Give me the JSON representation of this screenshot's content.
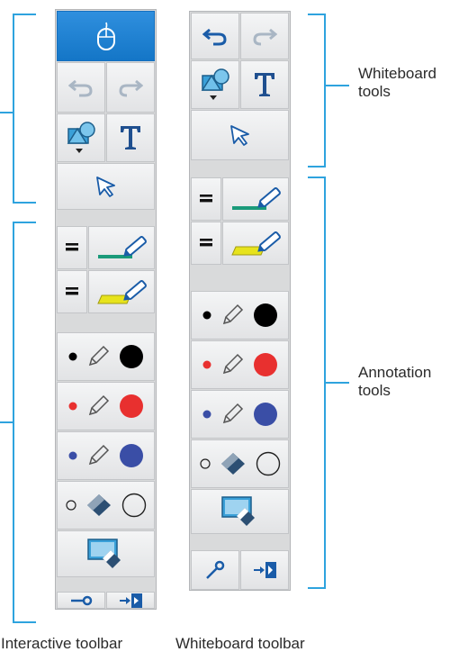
{
  "labels": {
    "whiteboard_tools": "Whiteboard tools",
    "annotation_tools": "Annotation tools"
  },
  "captions": {
    "interactive_toolbar": "Interactive toolbar",
    "whiteboard_toolbar": "Whiteboard toolbar"
  },
  "colors": {
    "accent_blue": "#2ea3de",
    "active_button": "#1476c7",
    "pen_black": "#000000",
    "pen_red": "#e8302f",
    "pen_blue": "#3a4ea6",
    "highlighter_green": "#1a9a7a",
    "highlighter_yellow": "#e7e31c"
  },
  "icons": [
    "mouse-icon",
    "undo-icon",
    "redo-icon",
    "shapes-icon",
    "text-icon",
    "select-arrow-icon",
    "pen-width-icon",
    "pen-icon",
    "highlighter-icon",
    "dot-icon",
    "pencil-icon",
    "eraser-icon",
    "clear-screen-icon",
    "pin-icon",
    "exit-icon"
  ]
}
